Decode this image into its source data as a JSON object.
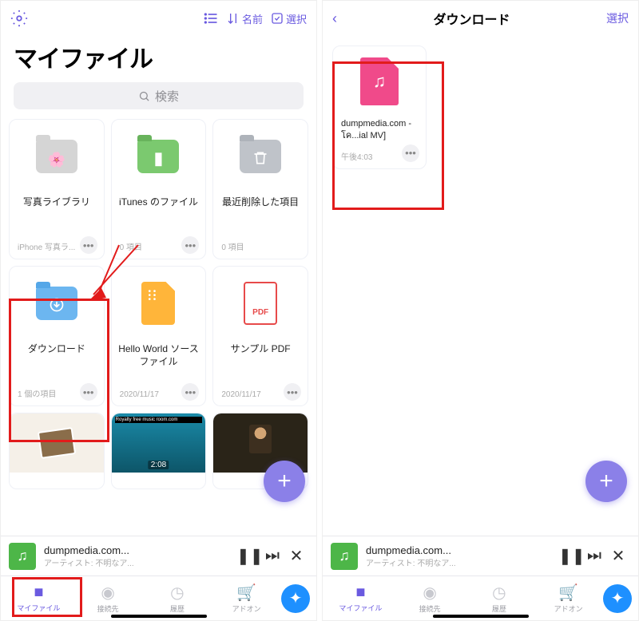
{
  "screen1": {
    "topbar": {
      "sort_label": "名前",
      "select_label": "選択"
    },
    "title": "マイファイル",
    "search_placeholder": "検索",
    "cards": [
      {
        "label": "写真ライブラリ",
        "meta": "iPhone 写真ラ..."
      },
      {
        "label": "iTunes のファイル",
        "meta": "0 項目"
      },
      {
        "label": "最近削除した項目",
        "meta": "0 項目"
      },
      {
        "label": "ダウンロード",
        "meta": "1 個の項目"
      },
      {
        "label": "Hello World ソースファイル",
        "meta": "2020/11/17"
      },
      {
        "label": "サンプル PDF",
        "meta": "2020/11/17"
      }
    ],
    "pdf_label": "PDF",
    "thumb2_text": "Royalty free music room.com",
    "thumb2_time": "2:08",
    "player": {
      "title": "dumpmedia.com...",
      "artist": "アーティスト: 不明なア..."
    },
    "tabs": {
      "files": "マイファイル",
      "connect": "接続先",
      "history": "履歴",
      "addon": "アドオン"
    }
  },
  "screen2": {
    "nav_title": "ダウンロード",
    "select_label": "選択",
    "item": {
      "label": "dumpmedia.com - โค...ial MV]",
      "meta": "午後4:03"
    },
    "player": {
      "title": "dumpmedia.com...",
      "artist": "アーティスト: 不明なア..."
    },
    "tabs": {
      "files": "マイファイル",
      "connect": "接続先",
      "history": "履歴",
      "addon": "アドオン"
    }
  }
}
